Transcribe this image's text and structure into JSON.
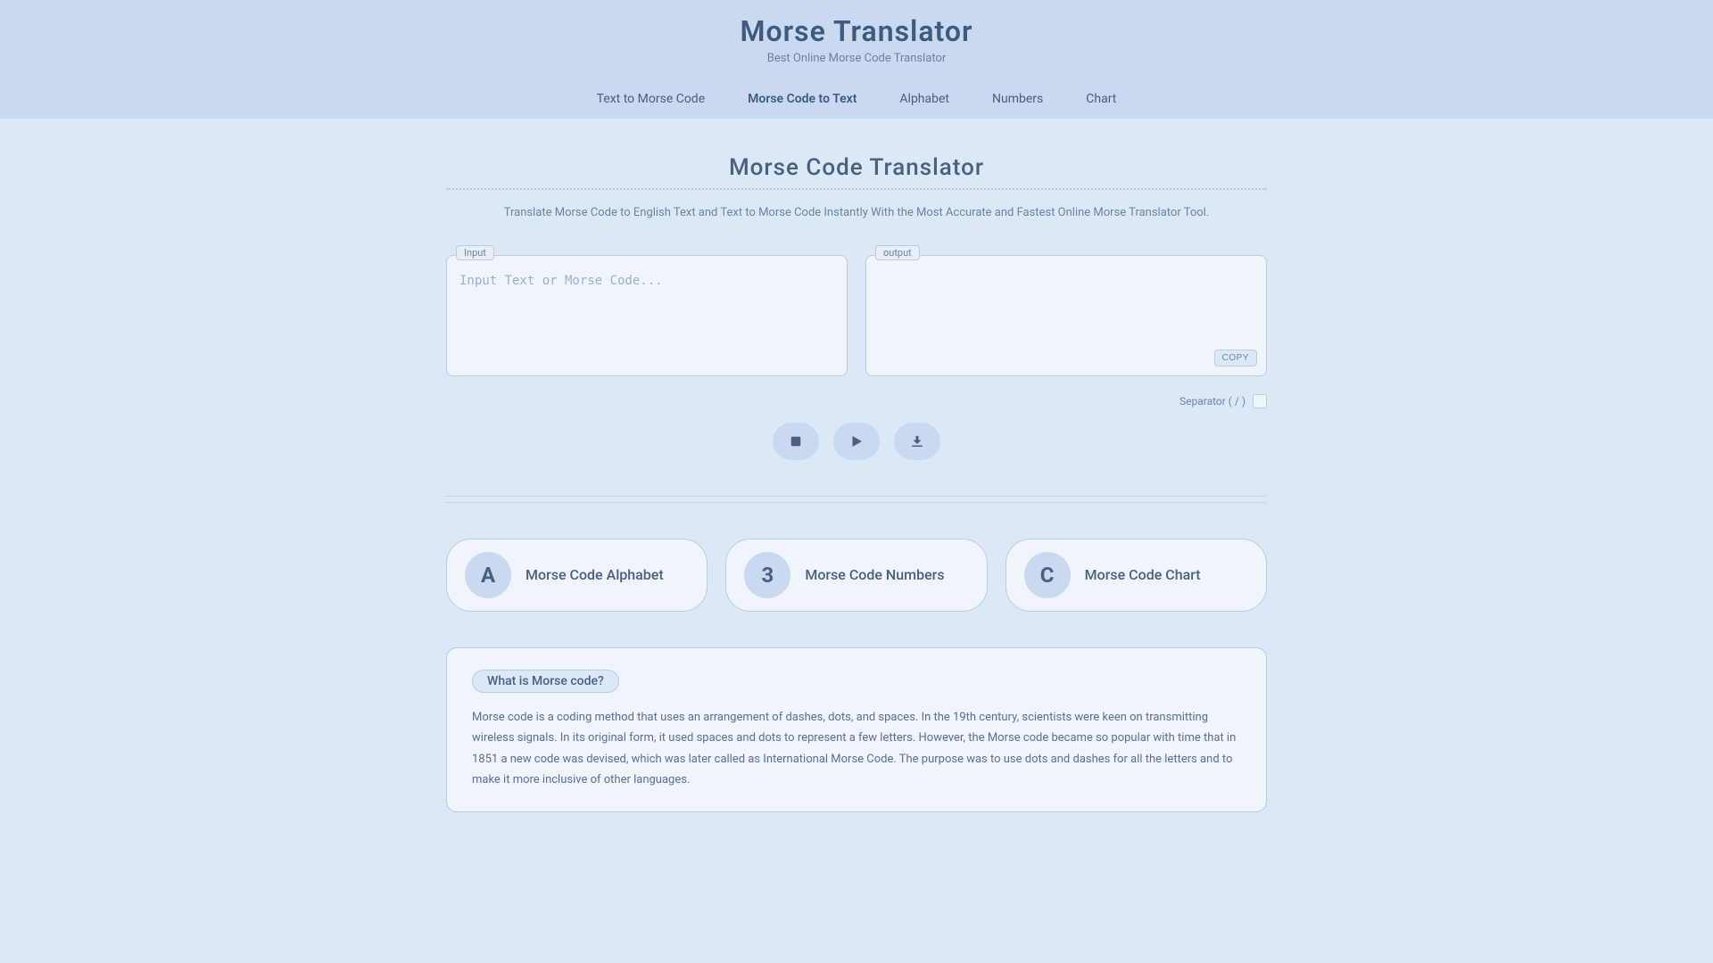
{
  "header": {
    "title": "Morse Translator",
    "subtitle": "Best Online Morse Code Translator"
  },
  "nav": {
    "items": [
      {
        "label": "Text to Morse Code",
        "active": false
      },
      {
        "label": "Morse Code to Text",
        "active": true
      },
      {
        "label": "Alphabet",
        "active": false
      },
      {
        "label": "Numbers",
        "active": false
      },
      {
        "label": "Chart",
        "active": false
      }
    ]
  },
  "main": {
    "page_title": "Morse Code Translator",
    "description": "Translate Morse Code to English Text and Text to Morse Code Instantly With the Most Accurate and Fastest Online Morse Translator Tool.",
    "input_label": "Input",
    "input_placeholder": "Input Text or Morse Code...",
    "output_label": "output",
    "copy_button": "COPY",
    "separator_label": "Separator ( / )",
    "controls": {
      "stop_title": "Stop",
      "play_title": "Play",
      "download_title": "Download"
    },
    "feature_cards": [
      {
        "icon": "A",
        "label": "Morse Code Alphabet"
      },
      {
        "icon": "3",
        "label": "Morse Code Numbers"
      },
      {
        "icon": "C",
        "label": "Morse Code Chart"
      }
    ],
    "info": {
      "question": "What is Morse code?",
      "text": "Morse code is a coding method that uses an arrangement of dashes, dots, and spaces. In the 19th century, scientists were keen on transmitting wireless signals. In its original form, it used spaces and dots to represent a few letters. However, the Morse code became so popular with time that in 1851 a new code was devised, which was later called as International Morse Code. The purpose was to use dots and dashes for all the letters and to make it more inclusive of other languages."
    }
  }
}
